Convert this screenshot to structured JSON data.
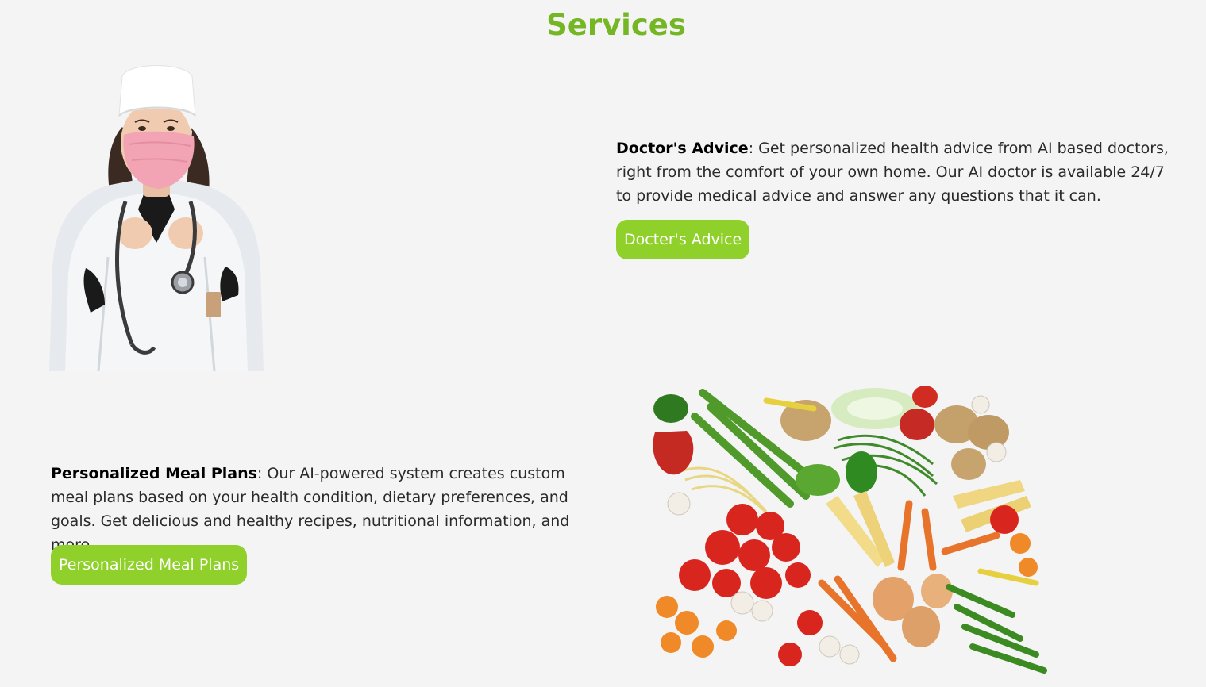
{
  "section": {
    "title": "Services"
  },
  "services": [
    {
      "name": "Doctor's Advice",
      "description": ": Get personalized health advice from AI based doctors, right from the comfort of your own home. Our AI doctor is available 24/7 to provide medical advice and answer any questions that it can.",
      "button_label": "Docter's Advice",
      "image": "doctor-with-mask-image"
    },
    {
      "name": "Personalized Meal Plans",
      "description": ": Our AI-powered system creates custom meal plans based on your health condition, dietary preferences, and goals. Get delicious and healthy recipes, nutritional information, and more.",
      "button_label": "Personalized Meal Plans",
      "image": "vegetables-image"
    }
  ],
  "colors": {
    "accent": "#74b624",
    "button": "#8fd12a",
    "background": "#f4f4f4"
  }
}
